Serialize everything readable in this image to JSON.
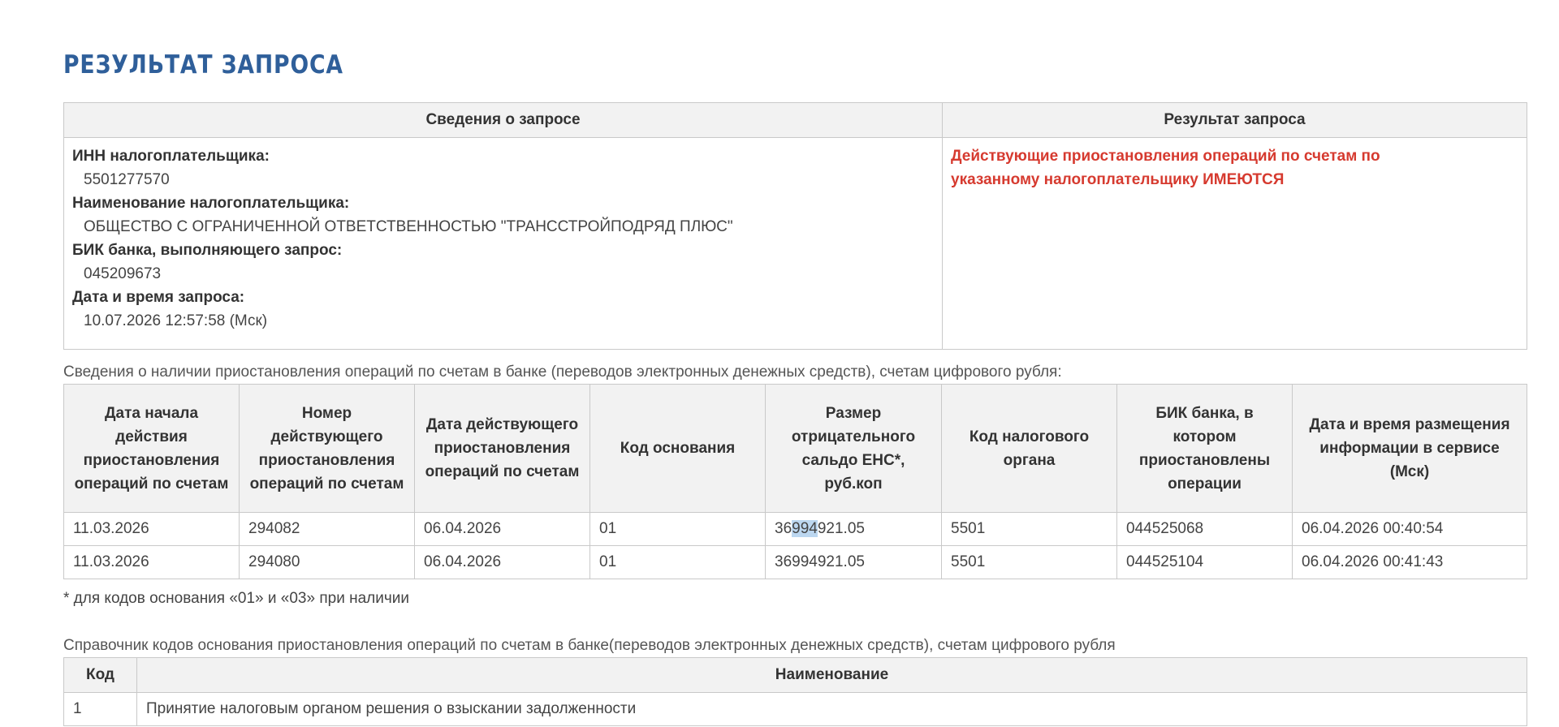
{
  "page_title": "РЕЗУЛЬТАТ ЗАПРОСА",
  "request_info": {
    "header_left": "Сведения о запросе",
    "header_right": "Результат запроса",
    "inn_label": "ИНН налогоплательщика:",
    "inn_value": "5501277570",
    "name_label": "Наименование налогоплательщика:",
    "name_value": "ОБЩЕСТВО С ОГРАНИЧЕННОЙ ОТВЕТСТВЕННОСТЬЮ \"ТРАНССТРОЙПОДРЯД ПЛЮС\"",
    "bik_label": "БИК банка, выполняющего запрос:",
    "bik_value": "045209673",
    "datetime_label": "Дата и время запроса:",
    "datetime_value": "10.07.2026 12:57:58 (Мск)",
    "result_line1": "Действующие приостановления операций по счетам по",
    "result_line2": "указанному налогоплательщику ИМЕЮТСЯ",
    "result_color": "#d63a2f"
  },
  "suspensions": {
    "caption": "Сведения о наличии приостановления операций по счетам в банке (переводов электронных денежных средств), счетам цифрового рубля:",
    "columns": [
      "Дата начала действия приостановления операций по счетам",
      "Номер действующего приостановления операций по счетам",
      "Дата действующего приостановления операций по счетам",
      "Код основания",
      "Размер отрицательного сальдо ЕНС*, руб.коп",
      "Код налогового органа",
      "БИК банка, в котором приостановлены операции",
      "Дата и время размещения информации в сервисе (Мск)"
    ],
    "rows": [
      [
        "11.03.2026",
        "294082",
        "06.04.2026",
        "01",
        "36994921.05",
        "5501",
        "044525068",
        "06.04.2026 00:40:54"
      ],
      [
        "11.03.2026",
        "294080",
        "06.04.2026",
        "01",
        "36994921.05",
        "5501",
        "044525104",
        "06.04.2026 00:41:43"
      ]
    ],
    "row1_amount_parts": [
      "36",
      "994",
      "921.05"
    ],
    "footnote": "* для кодов основания «01» и «03» при наличии"
  },
  "reference": {
    "caption": "Справочник кодов основания приостановления операций по счетам в банке(переводов электронных денежных средств), счетам цифрового рубля",
    "col_code": "Код",
    "col_name": "Наименование",
    "rows": [
      [
        "1",
        "Принятие налоговым органом решения о взыскании задолженности"
      ]
    ]
  },
  "colors": {
    "title": "#2f5f9a",
    "header_bg": "#f2f2f2",
    "border": "#c9c9c9",
    "selection": "#bcd7f0"
  }
}
